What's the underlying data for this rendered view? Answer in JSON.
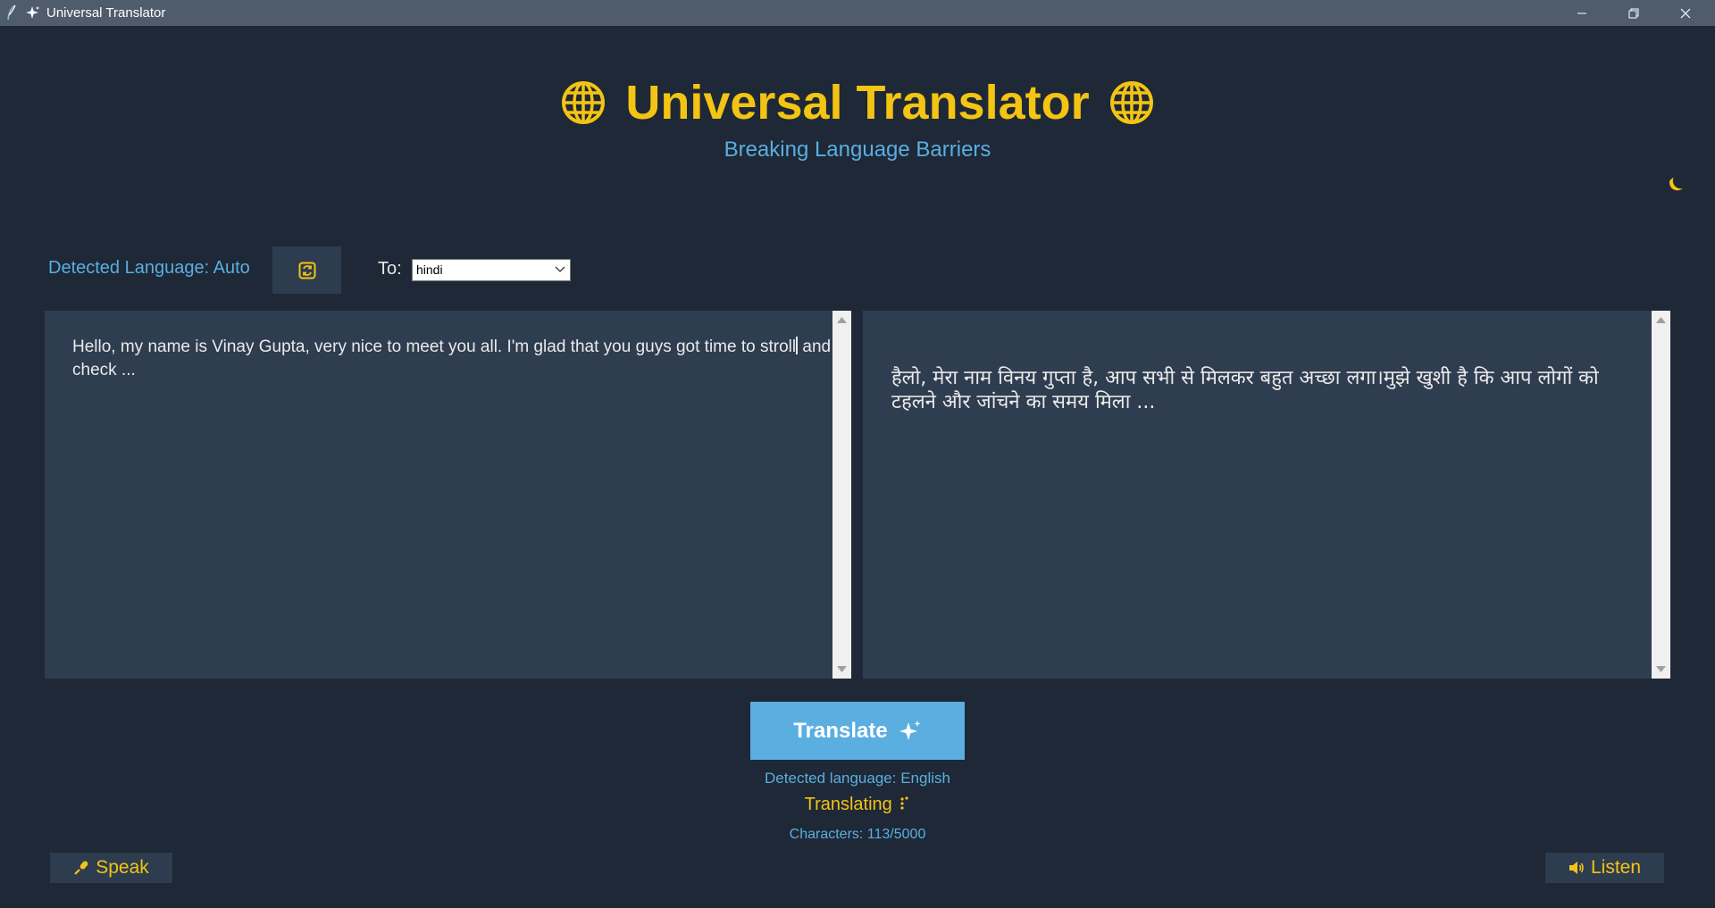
{
  "window": {
    "title": "Universal Translator"
  },
  "header": {
    "title": "Universal Translator",
    "subtitle": "Breaking Language Barriers",
    "theme_toggle_icon": "moon-icon"
  },
  "language_bar": {
    "detected_label": "Detected Language: Auto",
    "swap_icon": "swap-icon",
    "to_label": "To:",
    "target_language": "hindi"
  },
  "input": {
    "text_before_caret": "Hello, my name is Vinay Gupta, very nice to meet you all. I'm glad that you guys got time to stroll",
    "text_after_caret": " and check ..."
  },
  "output": {
    "text": "हैलो, मेरा नाम विनय गुप्ता है, आप सभी से मिलकर बहुत अच्छा लगा।मुझे खुशी है कि आप लोगों को टहलने और जांचने का समय मिला ..."
  },
  "actions": {
    "translate_label": "Translate",
    "detected_result": "Detected language: English",
    "status": "Translating",
    "char_count": "Characters: 113/5000",
    "speak_label": "Speak",
    "listen_label": "Listen"
  },
  "colors": {
    "background": "#1e2836",
    "panel": "#2f3d50",
    "accent_yellow": "#f3c413",
    "accent_blue": "#5aaee0",
    "titlebar": "#4f5c6c"
  }
}
